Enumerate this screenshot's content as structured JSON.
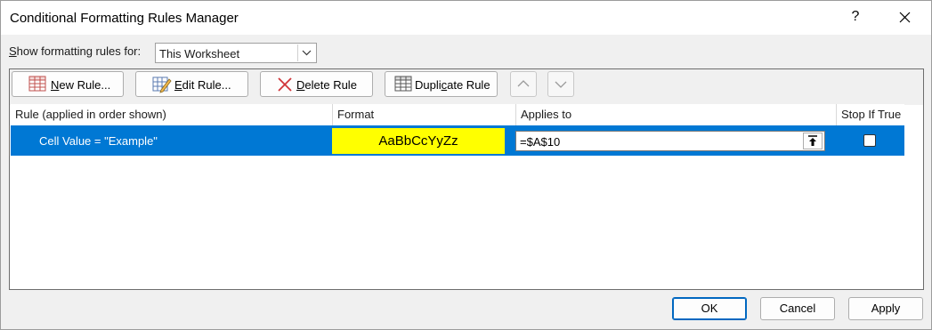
{
  "window": {
    "title": "Conditional Formatting Rules Manager",
    "help_glyph": "?",
    "close_icon": "close-icon"
  },
  "show_for": {
    "label_pre": "",
    "label_key": "S",
    "label_post": "how formatting rules for:",
    "selected": "This Worksheet"
  },
  "toolbar": {
    "new_rule": {
      "key": "N",
      "rest": "ew Rule..."
    },
    "edit_rule": {
      "key": "E",
      "rest": "dit Rule..."
    },
    "delete_rule": {
      "key": "D",
      "rest": "elete Rule"
    },
    "duplicate_rule": {
      "pre": "Dupli",
      "key": "c",
      "rest": "ate Rule"
    },
    "move_up_icon": "chevron-up-icon",
    "move_down_icon": "chevron-down-icon"
  },
  "grid": {
    "columns": [
      "Rule (applied in order shown)",
      "Format",
      "Applies to",
      "Stop If True"
    ],
    "rows": [
      {
        "rule": "Cell Value = \"Example\"",
        "format_preview": "AaBbCcYyZz",
        "applies_to": "=$A$10",
        "stop_if_true": false
      }
    ]
  },
  "buttons": {
    "ok": "OK",
    "cancel": "Cancel",
    "apply": "Apply"
  },
  "colors": {
    "selection": "#0078d4",
    "format_fill": "#ffff00",
    "delete_icon": "#d13438"
  }
}
